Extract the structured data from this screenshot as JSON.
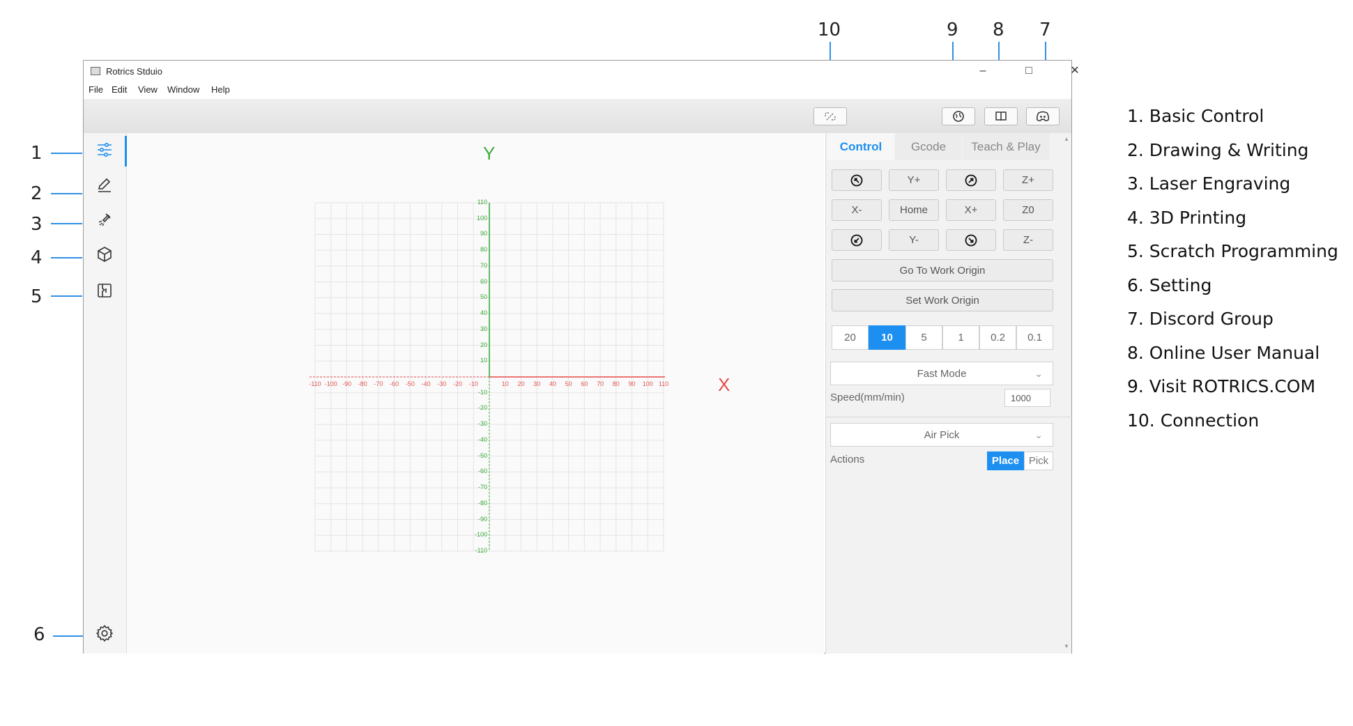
{
  "window": {
    "title": "Rotrics Stduio",
    "controls": [
      "–",
      "□",
      "✕"
    ],
    "menu": [
      "File",
      "Edit",
      "View",
      "Window",
      "Help"
    ]
  },
  "toolbar": {
    "connection_icon": "unlink-icon",
    "website_icon": "globe-icon",
    "manual_icon": "book-icon",
    "discord_icon": "discord-icon"
  },
  "sidebar": {
    "items": [
      {
        "name": "basic-control",
        "icon": "sliders-icon"
      },
      {
        "name": "drawing-writing",
        "icon": "pen-icon"
      },
      {
        "name": "laser-engraving",
        "icon": "laser-icon"
      },
      {
        "name": "3d-printing",
        "icon": "cube-icon"
      },
      {
        "name": "scratch-programming",
        "icon": "scratch-icon"
      }
    ],
    "settings_icon": "gear-icon"
  },
  "canvas": {
    "x_axis_label": "X",
    "y_axis_label": "Y",
    "x_ticks": [
      "-110",
      "-100",
      "-90",
      "-80",
      "-70",
      "-60",
      "-50",
      "-40",
      "-30",
      "-20",
      "-10",
      "10",
      "20",
      "30",
      "40",
      "50",
      "60",
      "70",
      "80",
      "90",
      "100",
      "110"
    ],
    "y_ticks": [
      "110",
      "100",
      "90",
      "80",
      "70",
      "60",
      "50",
      "40",
      "30",
      "20",
      "10",
      "-10",
      "-20",
      "-30",
      "-40",
      "-50",
      "-60",
      "-70",
      "-80",
      "-90",
      "-100",
      "-110"
    ],
    "x_color": "#e84a4a",
    "y_color": "#3caa3c"
  },
  "panel": {
    "tabs": [
      "Control",
      "Gcode",
      "Teach & Play"
    ],
    "active_tab": "Control",
    "jog": {
      "y_plus": "Y+",
      "z_plus": "Z+",
      "x_minus": "X-",
      "home": "Home",
      "x_plus": "X+",
      "z_zero": "Z0",
      "y_minus": "Y-",
      "z_minus": "Z-"
    },
    "go_to_work_origin": "Go To Work Origin",
    "set_work_origin": "Set Work Origin",
    "steps": [
      "20",
      "10",
      "5",
      "1",
      "0.2",
      "0.1"
    ],
    "active_step": "10",
    "mode": "Fast Mode",
    "speed_label": "Speed(mm/min)",
    "speed_value": "1000",
    "end_effector": "Air Pick",
    "actions_label": "Actions",
    "action_place": "Place",
    "action_pick": "Pick",
    "accent": "#1c8ff0"
  },
  "callouts": [
    "1",
    "2",
    "3",
    "4",
    "5",
    "6",
    "7",
    "8",
    "9",
    "10"
  ],
  "legend": [
    "1. Basic Control",
    "2. Drawing & Writing",
    "3. Laser Engraving",
    "4. 3D Printing",
    "5. Scratch Programming",
    "6. Setting",
    "7. Discord Group",
    "8. Online User Manual",
    "9.  Visit ROTRICS.COM",
    "10. Connection"
  ]
}
